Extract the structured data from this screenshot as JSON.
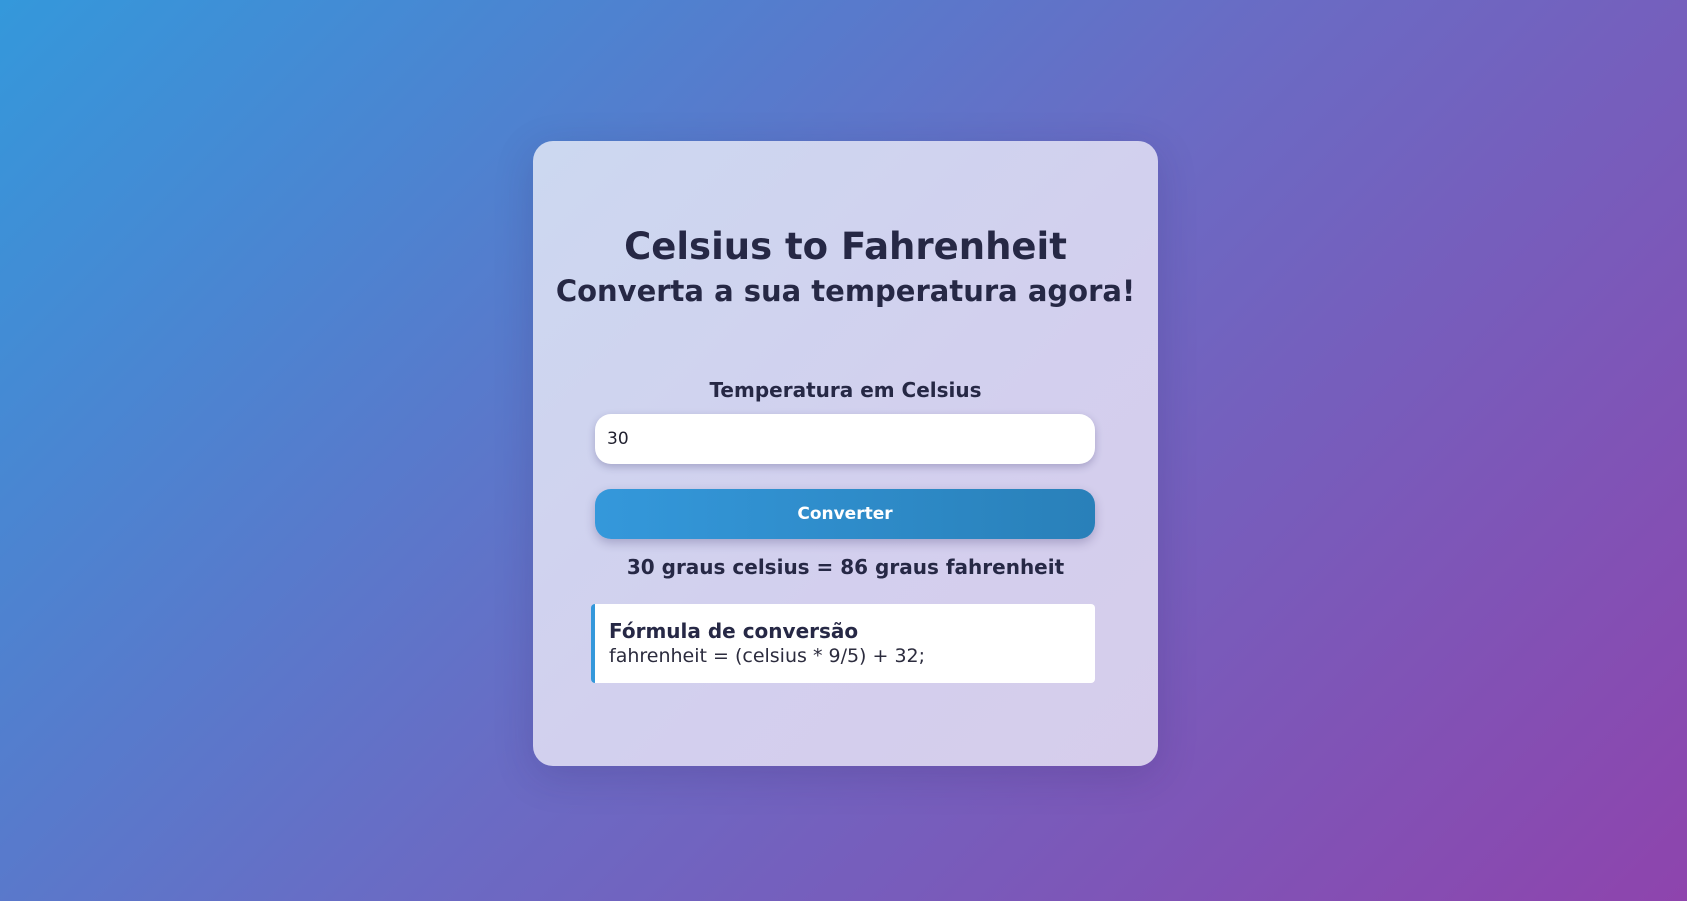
{
  "header": {
    "title": "Celsius to Fahrenheit",
    "subtitle": "Converta a sua temperatura agora!"
  },
  "form": {
    "label": "Temperatura em Celsius",
    "input_value": "30",
    "button_label": "Converter"
  },
  "result": {
    "text": "30 graus celsius = 86 graus fahrenheit"
  },
  "formula": {
    "title": "Fórmula de conversão",
    "text": "fahrenheit = (celsius * 9/5) + 32;"
  },
  "colors": {
    "accent": "#3498db",
    "accent_dark": "#2980b9",
    "text": "#262845",
    "background_start": "#3498db",
    "background_end": "#8e44ad"
  }
}
